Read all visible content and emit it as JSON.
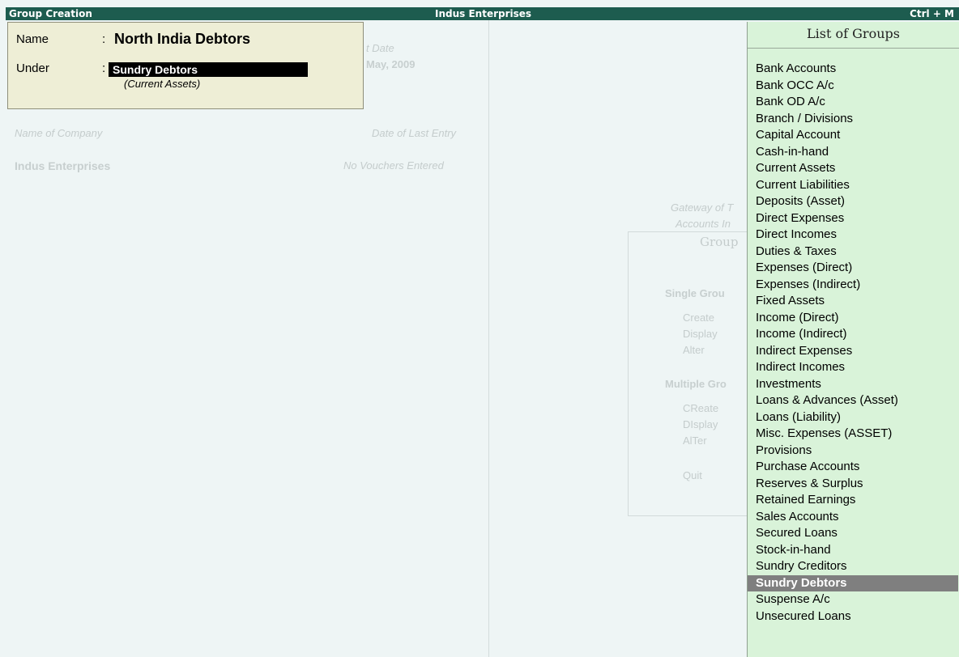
{
  "titlebar": {
    "left": "Group Creation",
    "center": "Indus Enterprises",
    "right": "Ctrl + M"
  },
  "background": {
    "period_label": "t Date",
    "period_value": "May, 2009",
    "col_company": "Name of Company",
    "col_last_entry": "Date of Last Entry",
    "company_name": "Indus Enterprises",
    "company_entries": "No Vouchers Entered",
    "gateway_line1": "Gateway of T",
    "gateway_line2": "Accounts In",
    "menu_title": "Group",
    "single_heading": "Single Grou",
    "single_items": [
      "Create",
      "Display",
      "Alter"
    ],
    "multiple_heading": "Multiple Gro",
    "multiple_items": [
      "CReate",
      "DIsplay",
      "AlTer"
    ],
    "quit": "Quit"
  },
  "form": {
    "name_label": "Name",
    "name_colon": ":",
    "name_value": "North India Debtors",
    "under_label": "Under",
    "under_colon": ":",
    "under_value": "Sundry Debtors",
    "under_parent": "(Current Assets)"
  },
  "list": {
    "title": "List of Groups",
    "items": [
      "Bank Accounts",
      "Bank OCC A/c",
      "Bank OD A/c",
      "Branch / Divisions",
      "Capital Account",
      "Cash-in-hand",
      "Current Assets",
      "Current Liabilities",
      "Deposits (Asset)",
      "Direct Expenses",
      "Direct Incomes",
      "Duties & Taxes",
      "Expenses (Direct)",
      "Expenses (Indirect)",
      "Fixed Assets",
      "Income (Direct)",
      "Income (Indirect)",
      "Indirect Expenses",
      "Indirect Incomes",
      "Investments",
      "Loans & Advances (Asset)",
      "Loans (Liability)",
      "Misc. Expenses (ASSET)",
      "Provisions",
      "Purchase Accounts",
      "Reserves & Surplus",
      "Retained Earnings",
      "Sales Accounts",
      "Secured Loans",
      "Stock-in-hand",
      "Sundry Creditors",
      "Sundry Debtors",
      "Suspense A/c",
      "Unsecured Loans"
    ],
    "selected": "Sundry Debtors"
  },
  "colors": {
    "titlebar": "#1d5c4f",
    "panel": "#d9f3d9",
    "form": "#eeeed6",
    "selection": "#7f7f7f"
  }
}
